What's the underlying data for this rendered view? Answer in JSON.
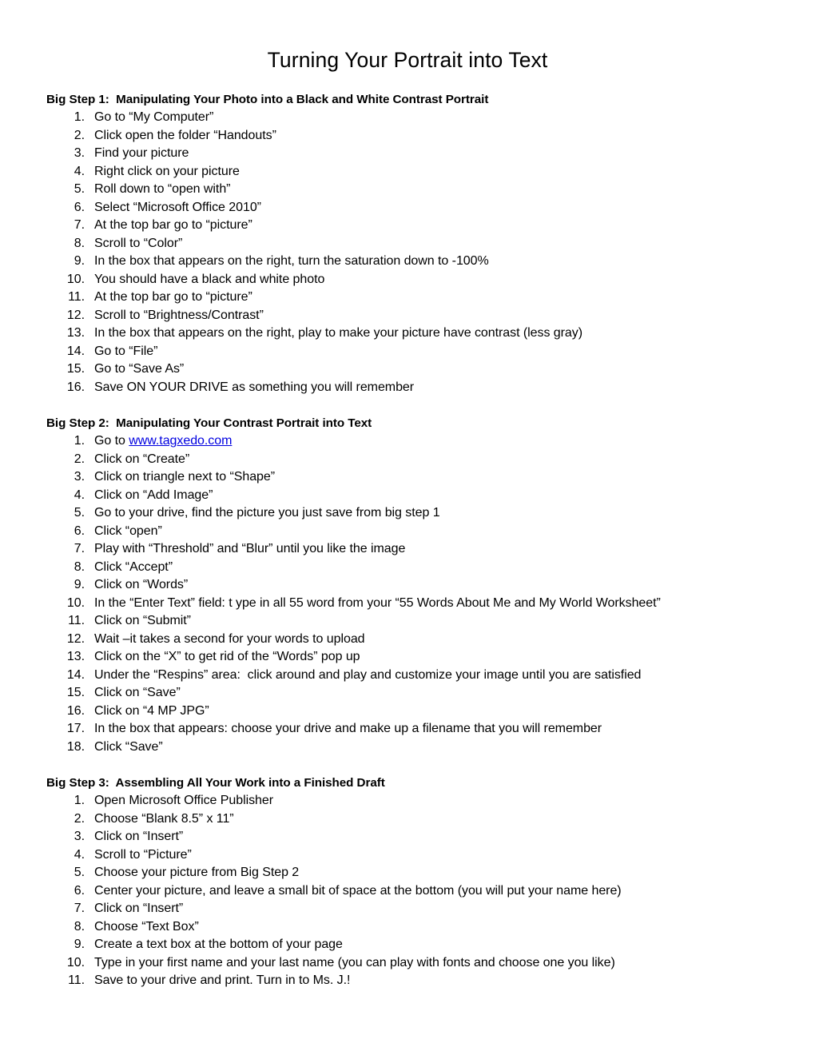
{
  "document": {
    "title": "Turning Your Portrait into Text",
    "link_color": "#0000E0",
    "text_color": "#000000",
    "background_color": "#FFFFFF"
  },
  "sections": [
    {
      "heading": "Big Step 1:  Manipulating Your Photo into a Black and White Contrast Portrait",
      "steps": [
        "Go to “My Computer”",
        "Click open the folder “Handouts”",
        "Find your picture",
        "Right click on your picture",
        "Roll down to “open with”",
        "Select “Microsoft Office 2010”",
        "At the top bar go to “picture”",
        "Scroll to “Color”",
        "In the box that appears on the right, turn the saturation down to -100%",
        "You should have a black and white photo",
        "At the top bar go to “picture”",
        "Scroll to “Brightness/Contrast”",
        "In the box that appears on the right, play to make your picture have contrast (less gray)",
        "Go to “File”",
        "Go to “Save As”",
        "Save ON YOUR DRIVE as something you will remember"
      ]
    },
    {
      "heading": "Big Step 2:  Manipulating Your Contrast Portrait into Text",
      "steps": [
        {
          "prefix": "Go to ",
          "link": "www.tagxedo.com",
          "suffix": ""
        },
        "Click on “Create”",
        "Click on triangle next to “Shape”",
        "Click on “Add Image”",
        "Go to your drive, find the picture you just save from big step 1",
        "Click “open”",
        "Play with “Threshold” and “Blur” until you like the image",
        "Click “Accept”",
        "Click on “Words”",
        "In the “Enter Text” field: t ype in all 55 word from your “55 Words About Me and My World Worksheet”",
        "Click on “Submit”",
        "Wait –it takes a second for your words to upload",
        "Click on the “X” to get rid of the “Words” pop up",
        "Under the “Respins” area:  click around and play and customize your image until you are satisfied",
        "Click on “Save”",
        "Click on “4 MP JPG”",
        "In the box that appears: choose your drive and make up a filename that you will remember",
        "Click “Save”"
      ]
    },
    {
      "heading": "Big Step 3:  Assembling All Your Work into a Finished Draft",
      "steps": [
        "Open Microsoft Office Publisher",
        "Choose “Blank 8.5” x 11”",
        "Click on “Insert”",
        "Scroll to “Picture”",
        "Choose your picture from Big Step 2",
        "Center your picture, and leave a small bit of space at the bottom (you will put your name here)",
        "Click on “Insert”",
        "Choose “Text Box”",
        "Create a text box at the bottom of your page",
        "Type in your first name and your last name (you can play with fonts and choose one you like)",
        "Save to your drive and print. Turn in to Ms. J.!"
      ]
    }
  ]
}
